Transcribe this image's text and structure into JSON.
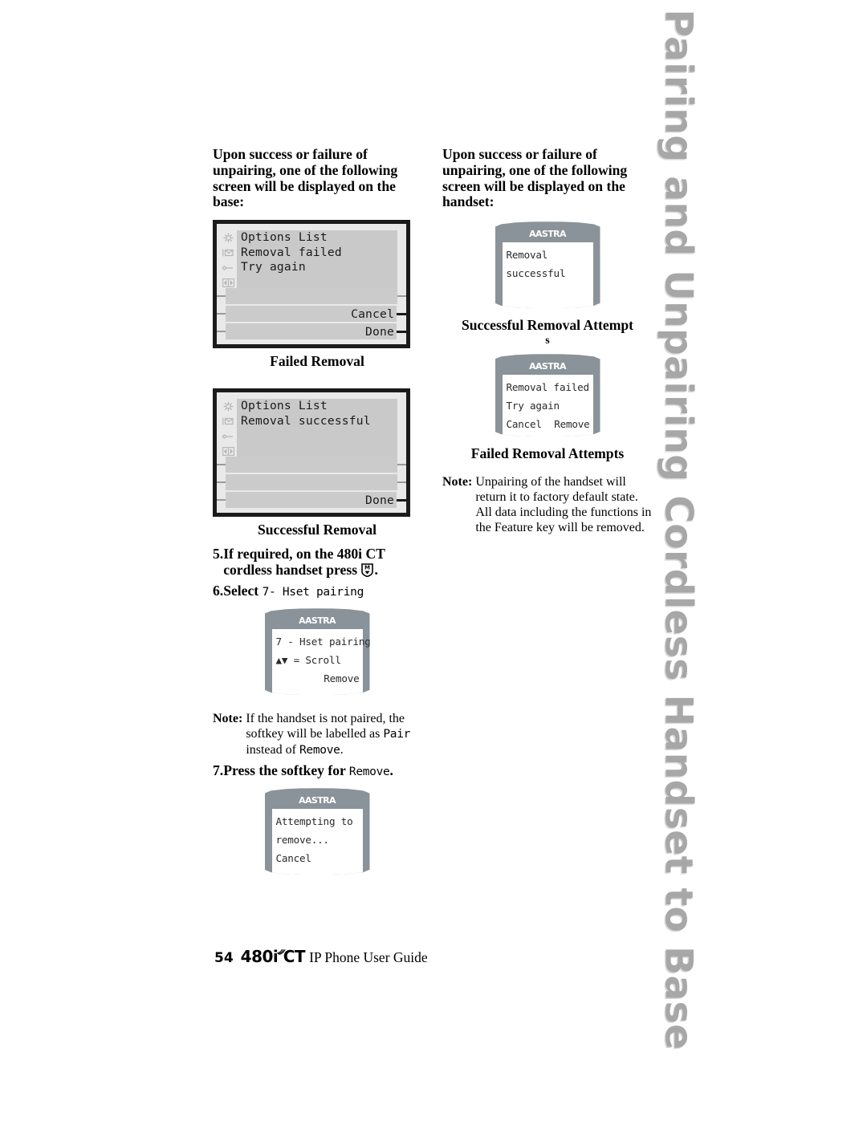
{
  "side_tab": {
    "text": "Pairing and Unpairing Cordless Handset to Base",
    "color": "#a7a7a7"
  },
  "left_column": {
    "intro": "Upon success or failure of unpairing, one of the following screen will be displayed on the base:",
    "figure_failed": {
      "caption": "Failed Removal",
      "lcd_lines": [
        "Options List",
        "Removal failed",
        "Try again",
        ""
      ],
      "icons": [
        "options-icon",
        "envelope-icon",
        "line-icon",
        "nav-icon"
      ],
      "softkeys": [
        "",
        "Cancel",
        "Done"
      ]
    },
    "figure_success": {
      "caption": "Successful Removal",
      "lcd_lines": [
        "Options List",
        "Removal successful",
        "",
        ""
      ],
      "icons": [
        "options-icon",
        "envelope-icon",
        "line-icon",
        "nav-icon"
      ],
      "softkeys": [
        "",
        "",
        "Done"
      ]
    },
    "step5": {
      "num": "5.",
      "text_a": "If required, on the 480i CT cordless handset press ",
      "key": "M",
      "text_b": "."
    },
    "step6": {
      "num": "6.",
      "label": "Select ",
      "mono": "7- Hset pairing"
    },
    "figure_hset": {
      "logo": "AASTRA",
      "lines": [
        "7 - Hset pairing",
        "▲▼ = Scroll",
        "Remove"
      ]
    },
    "note1": {
      "label": "Note:",
      "part_a": "If the handset is not paired, the softkey will be labelled as ",
      "mono_a": "Pair",
      "part_b": " instead of ",
      "mono_b": "Remove",
      "part_c": "."
    },
    "step7": {
      "num": "7.",
      "label": "Press the softkey for ",
      "mono": "Remove",
      "tail": "."
    },
    "figure_attempting": {
      "logo": "AASTRA",
      "lines": [
        "Attempting to",
        "remove...",
        "Cancel"
      ]
    }
  },
  "right_column": {
    "intro": "Upon success or failure of unpairing, one of the following screen will be displayed on the handset:",
    "figure_success": {
      "logo": "AASTRA",
      "lines": [
        "Removal",
        "successful"
      ],
      "caption": "Successful Removal Attempt",
      "caption_overflow": "s"
    },
    "figure_failed": {
      "logo": "AASTRA",
      "lines": [
        "Removal failed",
        "Try again"
      ],
      "softkeys": [
        "Cancel",
        "Remove"
      ],
      "caption": "Failed Removal Attempts"
    },
    "note": {
      "label": "Note:",
      "text": "Unpairing of the handset will return it to factory default state. All data including the functions in the Feature key will be removed."
    }
  },
  "footer": {
    "page_number": "54",
    "model": "480i  CT",
    "guide": "IP Phone User Guide",
    "wifi_icon": "wireless-icon"
  }
}
